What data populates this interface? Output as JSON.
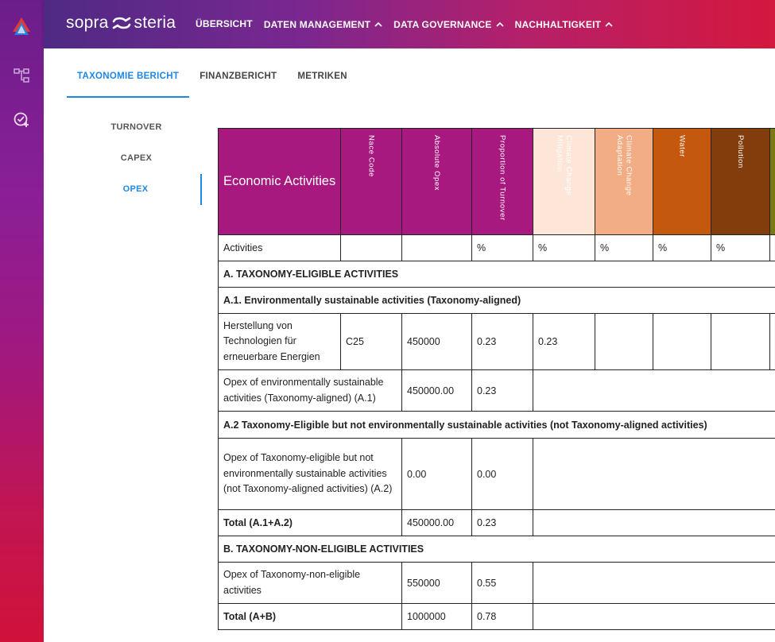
{
  "brand": {
    "left": "sopra",
    "right": "steria"
  },
  "nav": [
    {
      "label": "ÜBERSICHT",
      "has_chevron": false
    },
    {
      "label": "DATEN MANAGEMENT",
      "has_chevron": true
    },
    {
      "label": "DATA GOVERNANCE",
      "has_chevron": true
    },
    {
      "label": "NACHHALTIGKEIT",
      "has_chevron": true
    }
  ],
  "rail_icons": [
    "app-logo-icon",
    "hierarchy-icon",
    "task-check-add-icon"
  ],
  "tabs": [
    {
      "label": "TAXONOMIE BERICHT",
      "active": true
    },
    {
      "label": "FINANZBERICHT",
      "active": false
    },
    {
      "label": "METRIKEN",
      "active": false
    }
  ],
  "side": [
    {
      "label": "TURNOVER",
      "active": false
    },
    {
      "label": "CAPEX",
      "active": false
    },
    {
      "label": "OPEX",
      "active": true
    }
  ],
  "colors": {
    "magenta": "#a8197f",
    "cc_mitigation": "#fde5d8",
    "cc_adaptation": "#f3ad85",
    "water": "#c4580e",
    "pollution": "#833c0b",
    "next": "#7a7a10",
    "accent": "#1e88e5"
  },
  "table": {
    "headers": {
      "economic": "Economic Activities",
      "nace": "Nace Code",
      "abs": "Absolute Opex",
      "prop": "Proportion of Turnover",
      "ccm": "Climate Change Mitigation",
      "cca": "Climate Change Adaptation",
      "water": "Water",
      "pollution": "Pollution"
    },
    "units_row": {
      "label": "Activities",
      "prop": "%",
      "ccm": "%",
      "cca": "%",
      "water": "%",
      "pollution": "%"
    },
    "section_a": "A. TAXONOMY-ELIGIBLE ACTIVITIES",
    "section_a1": "A.1. Environmentally sustainable activities (Taxonomy-aligned)",
    "activity": {
      "name": "Herstellung von Technologien für erneuerbare Energien",
      "nace": "C25",
      "abs": "450000",
      "prop": "0.23",
      "ccm": "0.23"
    },
    "a1_total": {
      "label": "Opex of environmentally sustainable activities (Taxonomy-aligned) (A.1)",
      "abs": "450000.00",
      "prop": "0.23"
    },
    "section_a2": "A.2 Taxonomy-Eligible but not environmentally sustainable activities (not Taxonomy-aligned activities)",
    "a2_total": {
      "label": "Opex of Taxonomy-eligible but not environmentally sustainable activities (not Taxonomy-aligned activities) (A.2)",
      "abs": "0.00",
      "prop": "0.00"
    },
    "total_a": {
      "label": "Total (A.1+A.2)",
      "abs": "450000.00",
      "prop": "0.23"
    },
    "section_b": "B. TAXONOMY-NON-ELIGIBLE ACTIVITIES",
    "b_total": {
      "label": "Opex of Taxonomy-non-eligible activities",
      "abs": "550000",
      "prop": "0.55"
    },
    "total_ab": {
      "label": "Total (A+B)",
      "abs": "1000000",
      "prop": "0.78"
    }
  }
}
